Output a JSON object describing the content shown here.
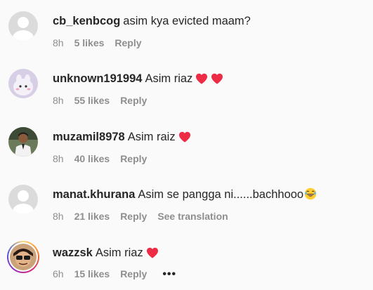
{
  "comments": [
    {
      "username": "cb_kenbcog",
      "text": "asim kya evicted maam?",
      "hearts": 0,
      "emoji": "",
      "time": "8h",
      "likes": "5 likes",
      "reply": "Reply",
      "extra": "",
      "avatar": "default-avatar"
    },
    {
      "username": "unknown191994",
      "text": "Asim riaz",
      "hearts": 2,
      "emoji": "",
      "time": "8h",
      "likes": "55 likes",
      "reply": "Reply",
      "extra": "",
      "avatar": "photo-avatar"
    },
    {
      "username": "muzamil8978",
      "text": "Asim raiz",
      "hearts": 1,
      "emoji": "",
      "time": "8h",
      "likes": "40 likes",
      "reply": "Reply",
      "extra": "",
      "avatar": "photo-avatar"
    },
    {
      "username": "manat.khurana",
      "text": "Asim se pangga ni......bachhooo",
      "hearts": 0,
      "emoji": "😂",
      "time": "8h",
      "likes": "21 likes",
      "reply": "Reply",
      "extra": "See translation",
      "avatar": "default-avatar"
    },
    {
      "username": "wazzsk",
      "text": "Asim riaz",
      "hearts": 1,
      "emoji": "",
      "time": "6h",
      "likes": "15 likes",
      "reply": "Reply",
      "extra": "•••",
      "avatar": "story-ring-avatar"
    }
  ],
  "colors": {
    "background": "#fafafa",
    "username": "#262626",
    "meta": "#8e8e8e",
    "heart": "#ed2b45"
  }
}
